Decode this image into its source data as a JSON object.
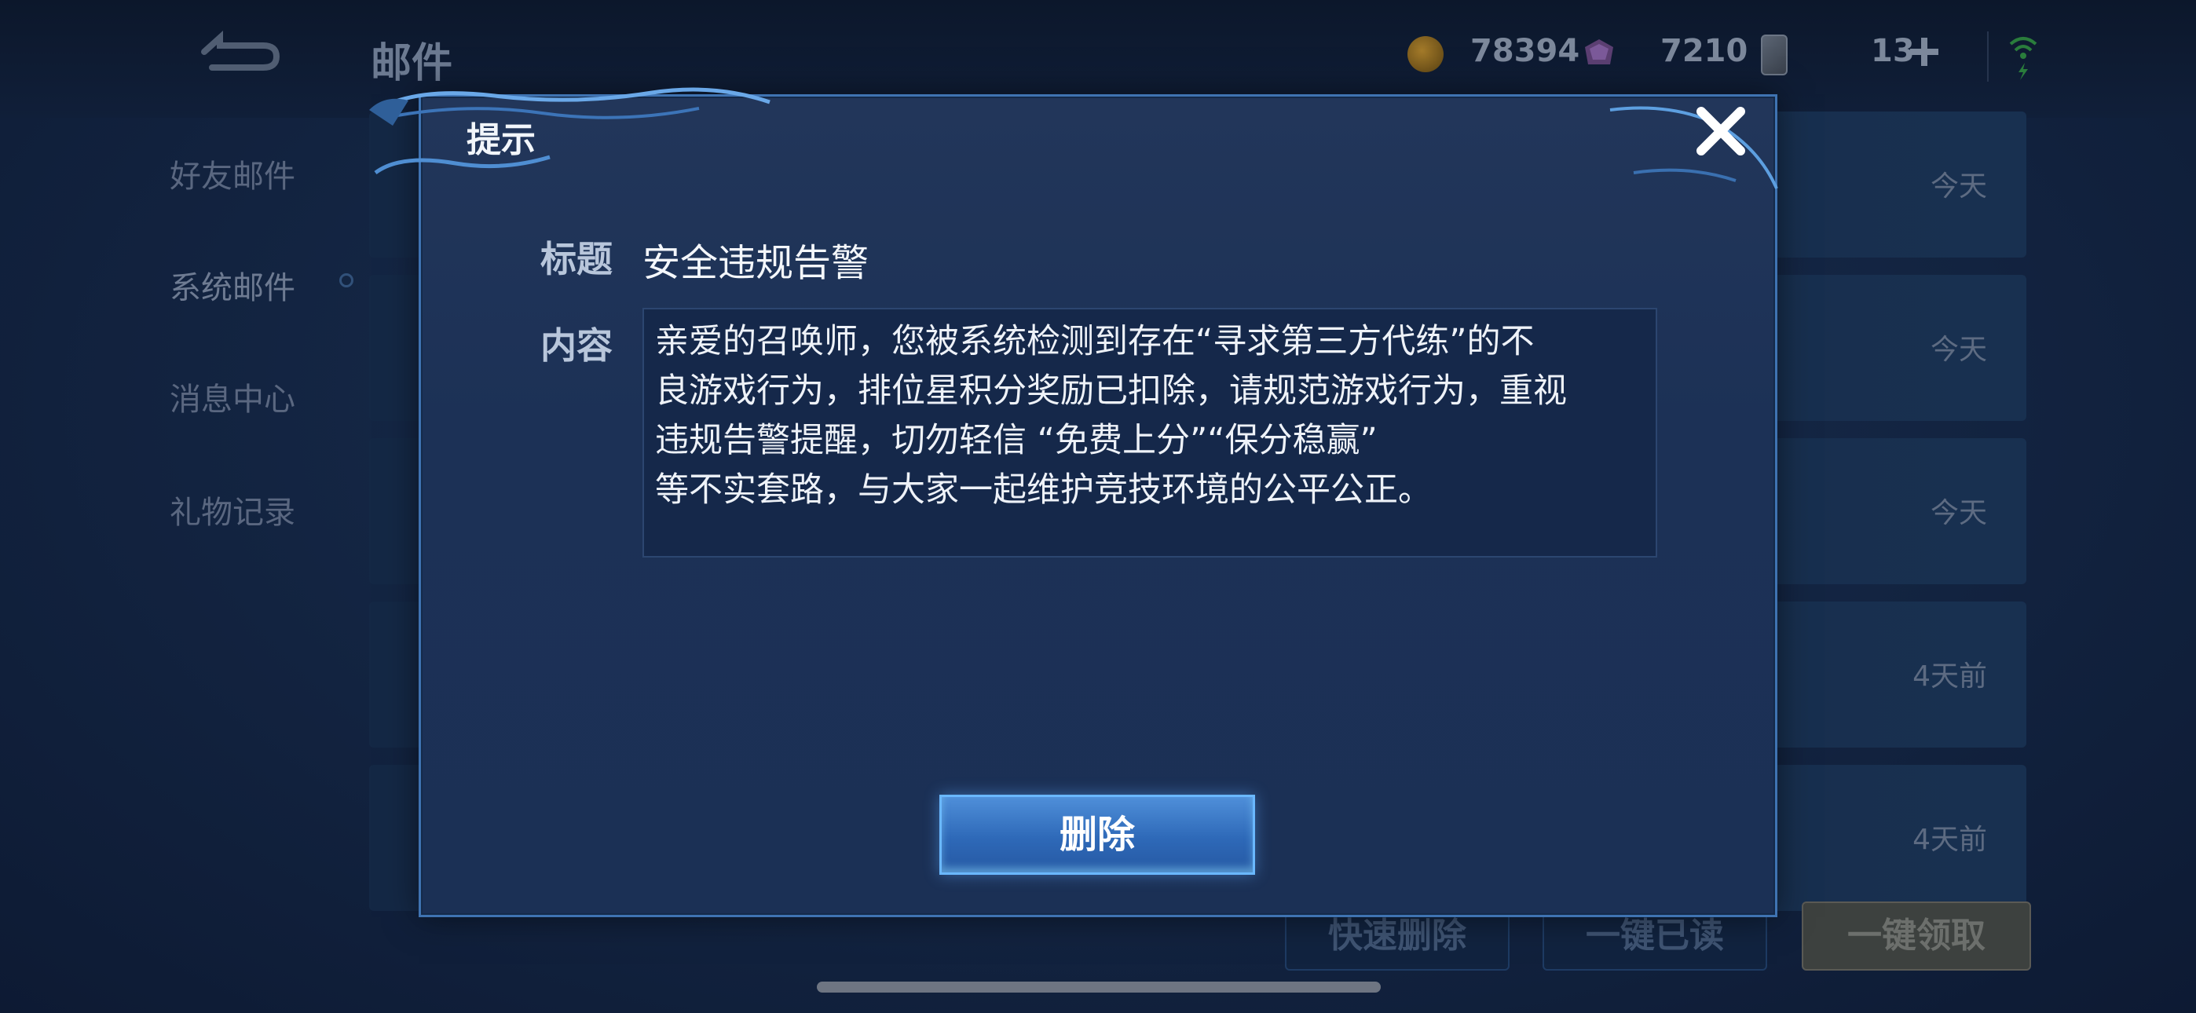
{
  "header": {
    "title": "邮件",
    "gold": "78394",
    "gems": "7210",
    "tickets": "13"
  },
  "sidebar": {
    "items": [
      {
        "label": "好友邮件"
      },
      {
        "label": "系统邮件"
      },
      {
        "label": "消息中心"
      },
      {
        "label": "礼物记录"
      }
    ]
  },
  "mail_list": {
    "rows": [
      {
        "time": "今天"
      },
      {
        "time": "今天"
      },
      {
        "time": "今天"
      },
      {
        "time": "4天前"
      },
      {
        "time": "4天前"
      }
    ]
  },
  "bottom_actions": {
    "quick_delete": "快速删除",
    "mark_all_read": "一键已读",
    "claim_all": "一键领取"
  },
  "dialog": {
    "title": "提示",
    "subject_label": "标题",
    "subject_value": "安全违规告警",
    "content_label": "内容",
    "content_text": "亲爱的召唤师，您被系统检测到存在“寻求第三方代练”的不\n良游戏行为，排位星积分奖励已扣除，请规范游戏行为，重视\n违规告警提醒，切勿轻信 “免费上分”“保分稳赢”\n等不实套路，与大家一起维护竞技环境的公平公正。",
    "delete_button": "删除"
  },
  "colors": {
    "accent": "#3f73b2",
    "button": "#2e69b8"
  }
}
